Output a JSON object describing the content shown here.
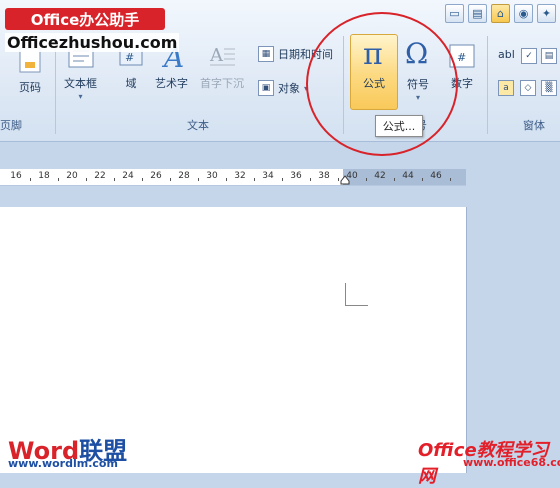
{
  "watermark_top": {
    "badge": "Office办公助手",
    "url": "Officezhushou.com"
  },
  "ribbon": {
    "groups": [
      {
        "label": "页脚"
      },
      {
        "label": "文本"
      },
      {
        "label": "符号"
      },
      {
        "label": "窗体"
      }
    ],
    "buttons": {
      "page_number": "页码",
      "textbox": "文本框",
      "field": "域",
      "wordart": "艺术字",
      "dropcap": "首字下沉",
      "datetime": "日期和时间",
      "object": "对象",
      "formula": "公式",
      "symbol": "符号",
      "number": "数字",
      "abl": "abl"
    },
    "tooltip": "公式..."
  },
  "ruler": {
    "ticks": [
      "16",
      "18",
      "20",
      "22",
      "24",
      "26",
      "28",
      "30",
      "32",
      "34",
      "36",
      "38",
      "40",
      "42",
      "44",
      "46"
    ]
  },
  "watermark_bottom": {
    "word_part1": "Word",
    "word_part2": "联盟",
    "word_url": "www.wordlm.com",
    "tutorial": "Office教程学习网",
    "tutorial_url": "www.office68.com"
  },
  "colors": {
    "ribbon_bg": "#dfe9f5",
    "highlight": "#fcd980",
    "annotation_circle": "#d8232a",
    "page_bg": "#ffffff"
  }
}
